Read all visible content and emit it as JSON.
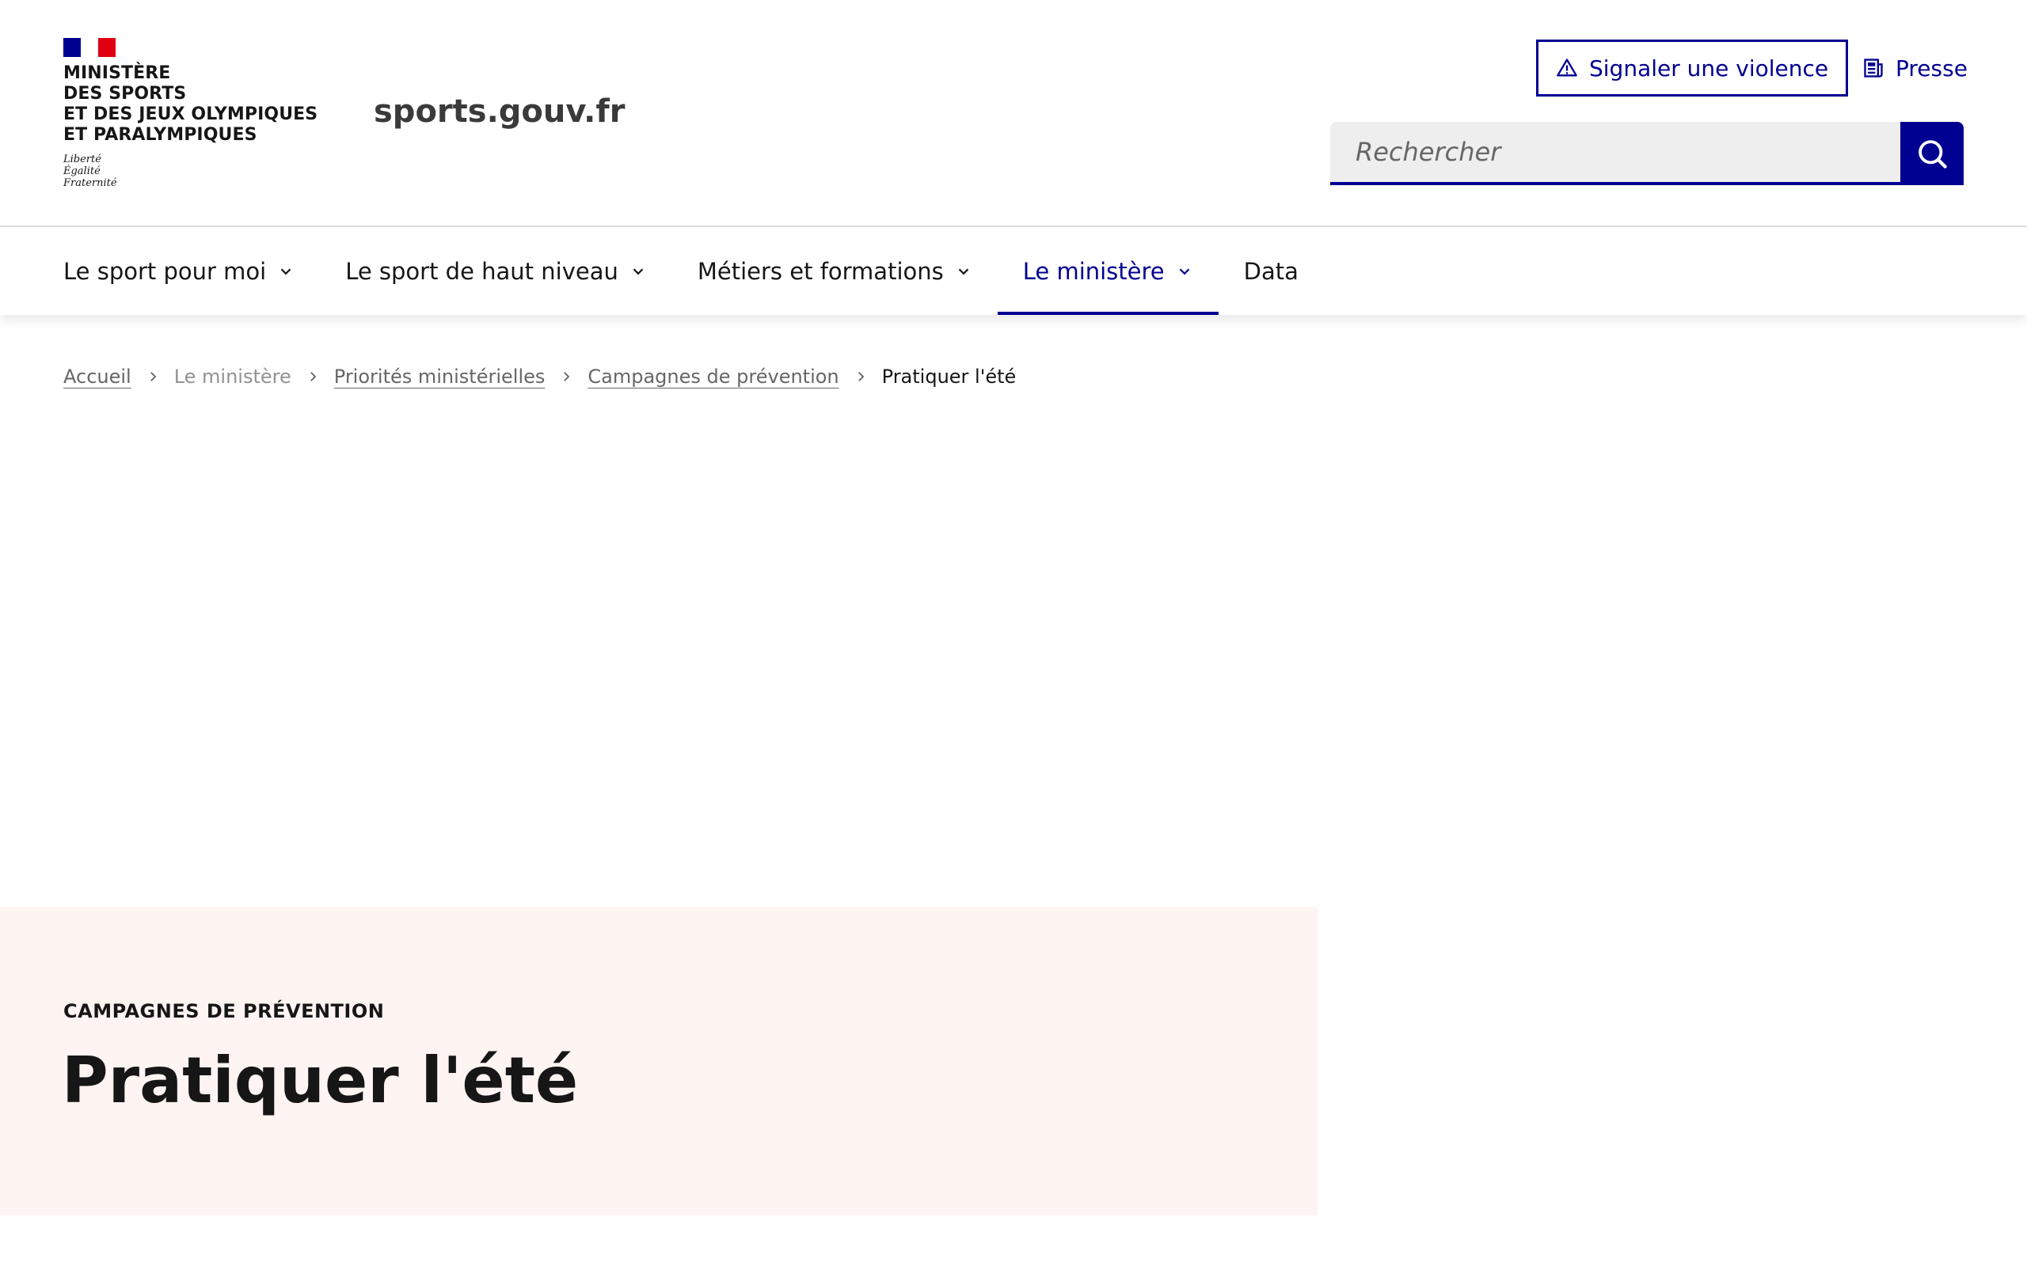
{
  "header": {
    "ministry_lines": [
      "MINISTÈRE",
      "DES SPORTS",
      "ET DES JEUX OLYMPIQUES",
      "ET PARALYMPIQUES"
    ],
    "motto": [
      "Liberté",
      "Égalité",
      "Fraternité"
    ],
    "site_name": "sports.gouv.fr",
    "report_button": "Signaler une violence",
    "press_link": "Presse",
    "search": {
      "placeholder": "Rechercher"
    },
    "flag_colors": {
      "blue": "#000091",
      "white": "#ffffff",
      "red": "#e1000f"
    }
  },
  "nav": {
    "items": [
      {
        "label": "Le sport pour moi",
        "has_dropdown": true
      },
      {
        "label": "Le sport de haut niveau",
        "has_dropdown": true
      },
      {
        "label": "Métiers et formations",
        "has_dropdown": true
      },
      {
        "label": "Le ministère",
        "has_dropdown": true,
        "active": true
      },
      {
        "label": "Data",
        "has_dropdown": false
      }
    ]
  },
  "breadcrumb": {
    "items": [
      "Accueil",
      "Le ministère",
      "Priorités ministérielles",
      "Campagnes de prévention",
      "Pratiquer l'été"
    ]
  },
  "hero": {
    "kicker": "Campagnes de prévention",
    "title": "Pratiquer l'été",
    "background": "#fef4f2"
  },
  "theme": {
    "accent": "#000091"
  }
}
